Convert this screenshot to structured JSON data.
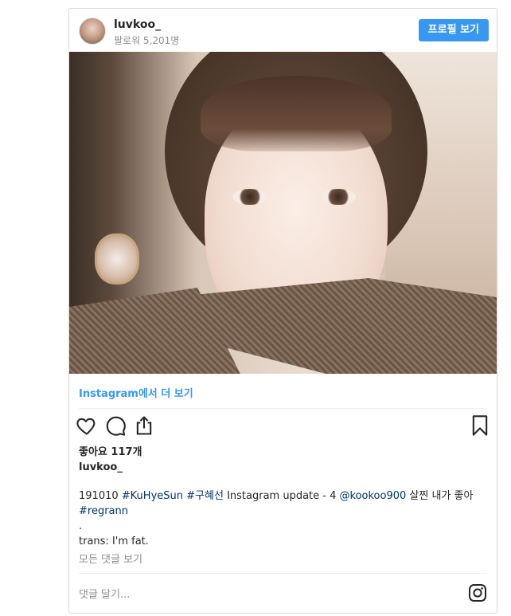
{
  "header": {
    "username": "luvkoo_",
    "followers": "팔로워 5,201명",
    "profile_button": "프로필 보기"
  },
  "post": {
    "more_link": "Instagram에서 더 보기",
    "likes": "좋아요 117개",
    "caption_user": "luvkoo_",
    "caption": {
      "date": "191010",
      "tag1": "#KuHyeSun",
      "tag2": "#구혜선",
      "text1": "Instagram update - 4",
      "mention": "@kookoo900",
      "text2": "살찐 내가 좋아",
      "tag3": "#regrann",
      "dot": ".",
      "trans": "trans: I'm fat."
    },
    "view_comments": "모든 댓글 보기",
    "comment_placeholder": "댓글 달기..."
  },
  "icons": [
    "heart-icon",
    "comment-icon",
    "share-icon",
    "bookmark-icon",
    "instagram-icon"
  ],
  "colors": {
    "accent": "#3897f0",
    "hashtag": "#003569",
    "muted": "#8e8e8e"
  }
}
